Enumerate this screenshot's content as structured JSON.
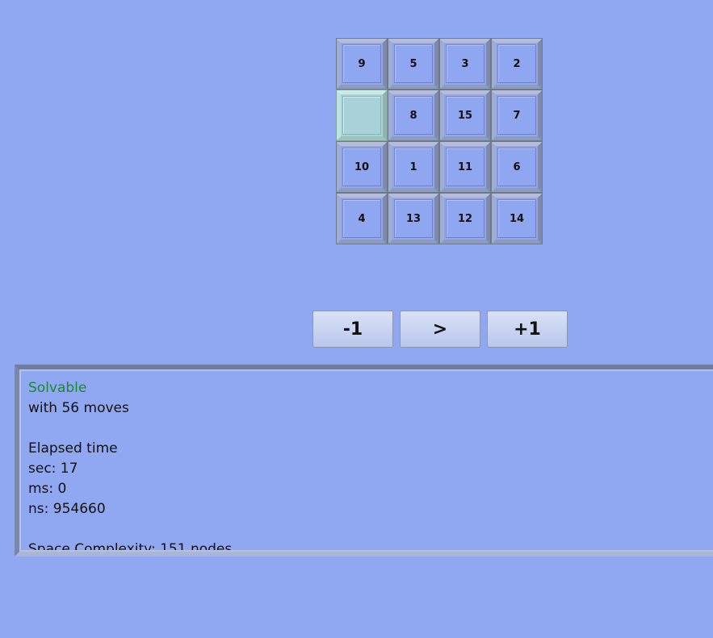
{
  "board": {
    "tiles": [
      "9",
      "5",
      "3",
      "2",
      "",
      "8",
      "15",
      "7",
      "10",
      "1",
      "11",
      "6",
      "4",
      "13",
      "12",
      "14"
    ]
  },
  "controls": {
    "prev_label": "-1",
    "play_label": ">",
    "next_label": "+1"
  },
  "info": {
    "status": "Solvable",
    "moves": "with 56 moves",
    "blank1": "",
    "elapsed_title": "Elapsed time",
    "sec": "sec: 17",
    "ms": "ms: 0",
    "ns": "ns: 954660",
    "blank2": "",
    "space": "Space Complexity: 151 nodes"
  },
  "colors": {
    "background": "#90a8f2",
    "status_solvable": "#1a8a2a",
    "blank_tile": "#a8d2d8"
  }
}
